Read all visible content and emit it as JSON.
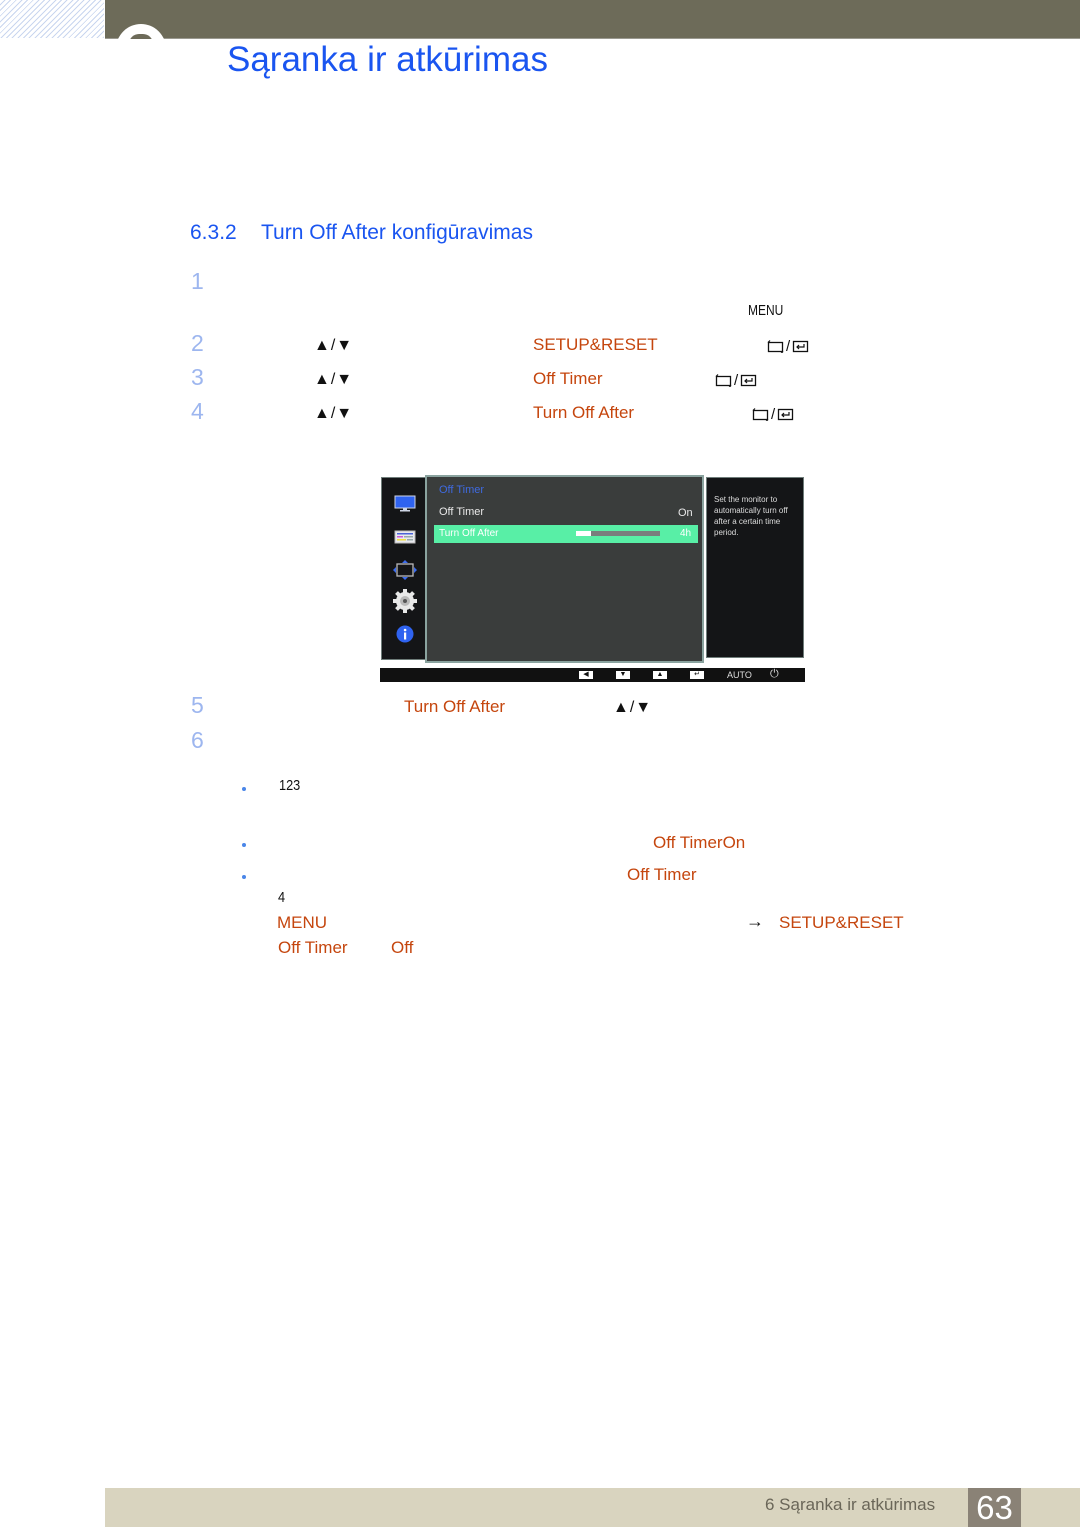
{
  "header": {
    "chapter_title": "Sąranka ir atkūrimas"
  },
  "section": {
    "number": "6.3.2",
    "title": "Turn Off After konfigūravimas"
  },
  "steps": [
    {
      "num": "1",
      "key": "MENU"
    },
    {
      "num": "2",
      "arrows": "▲/▼",
      "item": "SETUP&RESET"
    },
    {
      "num": "3",
      "arrows": "▲/▼",
      "item": "Off Timer"
    },
    {
      "num": "4",
      "arrows": "▲/▼",
      "item": "Turn Off After"
    },
    {
      "num": "5",
      "item": "Turn Off After",
      "arrows": "▲/▼"
    },
    {
      "num": "6"
    }
  ],
  "button_icons": {
    "source": "source-icon",
    "separator": "/",
    "enter": "enter-icon"
  },
  "osd": {
    "heading": "Off Timer",
    "rows": [
      {
        "label": "Off Timer",
        "value": "On"
      },
      {
        "label": "Turn Off After",
        "value": "4h",
        "progress": 0.18,
        "selected": true
      }
    ],
    "help_text": "Set the monitor to automatically turn off after a certain time period.",
    "sidebar_icons": [
      "picture-icon",
      "onscreen-display-icon",
      "position-icon",
      "setup-gear-icon",
      "information-icon"
    ],
    "bottom_keys": [
      "◀",
      "▼",
      "▲",
      "↵"
    ],
    "auto_label": "AUTO",
    "power_symbol": "⏻"
  },
  "notes": {
    "note1_value": "123",
    "bullet1_item": "Off TimerOn",
    "bullet2_item": "Off Timer",
    "bullet2_num": "4",
    "bullet2_menu": "MENU",
    "bullet2_arrow": "→",
    "bullet2_setup": "SETUP&RESET",
    "bullet2_off_timer": "Off Timer",
    "bullet2_off": "Off"
  },
  "footer": {
    "chapter_label": "6 Sąranka ir atkūrimas",
    "page_number": "63"
  }
}
